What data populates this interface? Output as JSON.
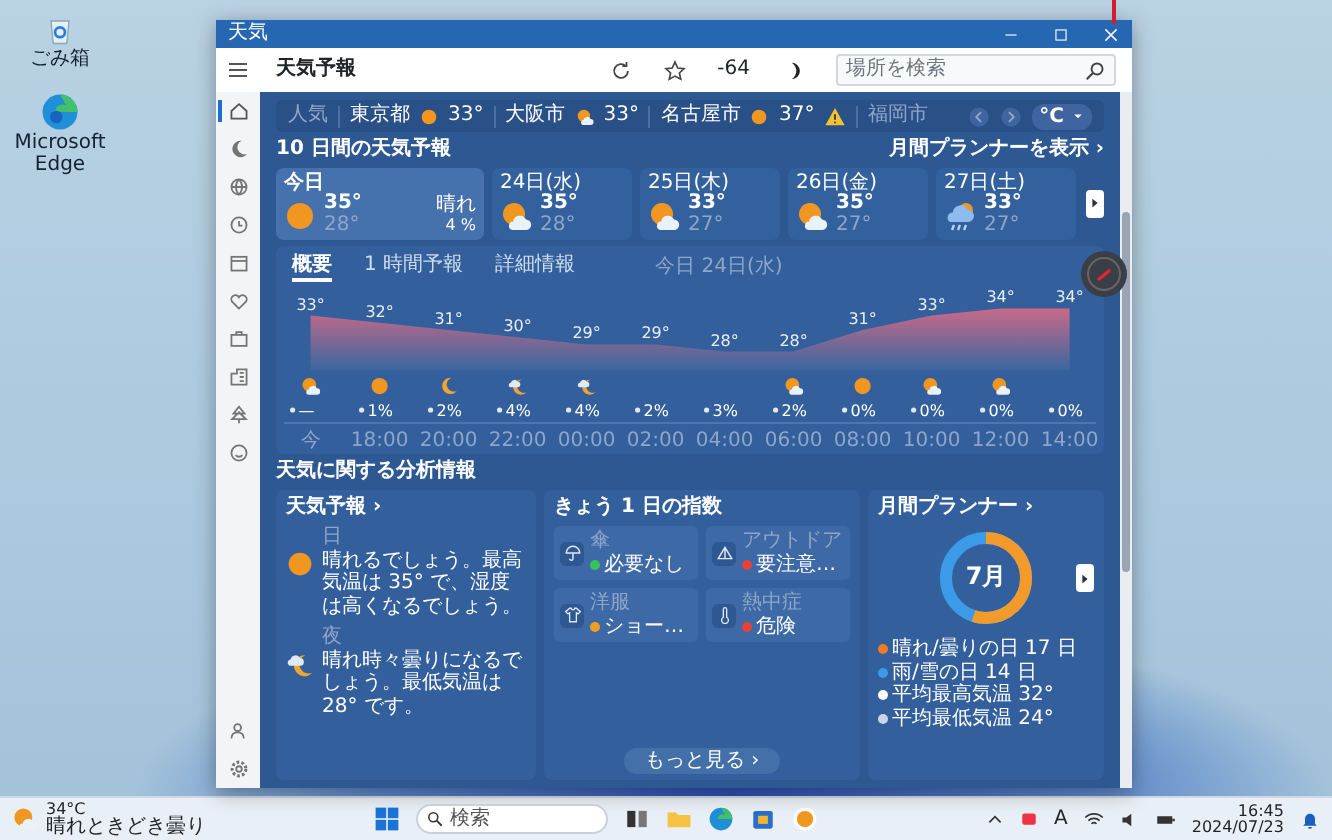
{
  "desktop_icons": [
    {
      "kind": "recycle-bin",
      "label": "ごみ箱"
    },
    {
      "kind": "browser",
      "label": "Microsoft Edge"
    }
  ],
  "window": {
    "title": "天気"
  },
  "header": {
    "title": "天気予報",
    "points": "-64",
    "search": {
      "placeholder": "場所を検索"
    }
  },
  "nav": [
    {
      "kind": "home",
      "selected": true
    },
    {
      "kind": "crescent",
      "selected": false
    },
    {
      "kind": "globe",
      "selected": false
    },
    {
      "kind": "clock",
      "selected": false
    },
    {
      "kind": "calendar",
      "selected": false
    },
    {
      "kind": "heart",
      "selected": false
    },
    {
      "kind": "briefcase",
      "selected": false
    },
    {
      "kind": "building",
      "selected": false
    },
    {
      "kind": "tree",
      "selected": false
    },
    {
      "kind": "smiley",
      "selected": false
    }
  ],
  "nav_bottom": [
    {
      "kind": "person",
      "selected": false
    },
    {
      "kind": "gear",
      "selected": false
    }
  ],
  "favorites": {
    "label": "人気",
    "unit": "°C",
    "cities": [
      {
        "name": "東京都",
        "kind": "sun",
        "temp": "33°",
        "alert": false,
        "disabled": false
      },
      {
        "name": "大阪市",
        "kind": "sun-cloud",
        "temp": "33°",
        "alert": false,
        "disabled": false
      },
      {
        "name": "名古屋市",
        "kind": "sun",
        "temp": "37°",
        "alert": true,
        "disabled": false
      },
      {
        "name": "福岡市",
        "alert": false,
        "disabled": true
      }
    ]
  },
  "forecast": {
    "title": "10 日間の天気予報",
    "link": "月間プランナーを表示 ›",
    "days": [
      {
        "label": "今日",
        "kind": "sun",
        "high": "35°",
        "low": "28°",
        "condition": "晴れ",
        "precip": "4 %",
        "selected": true
      },
      {
        "label": "24日(水)",
        "kind": "sun-cloud",
        "high": "35°",
        "low": "28°",
        "selected": false
      },
      {
        "label": "25日(木)",
        "kind": "sun-cloud",
        "high": "33°",
        "low": "27°",
        "selected": false
      },
      {
        "label": "26日(金)",
        "kind": "sun-cloud",
        "high": "35°",
        "low": "27°",
        "selected": false
      },
      {
        "label": "27日(土)",
        "kind": "cloud-rain",
        "high": "33°",
        "low": "27°",
        "selected": false
      }
    ]
  },
  "hourly": {
    "tabs": [
      {
        "label": "概要",
        "selected": true
      },
      {
        "label": "1 時間予報",
        "selected": false
      },
      {
        "label": "詳細情報",
        "selected": false
      }
    ],
    "day_label": "今日  24日(水)",
    "chart_data": {
      "type": "area",
      "categories": [
        "今",
        "18:00",
        "20:00",
        "22:00",
        "00:00",
        "02:00",
        "04:00",
        "06:00",
        "08:00",
        "10:00",
        "12:00",
        "14:00"
      ],
      "values": [
        33,
        32,
        31,
        30,
        29,
        29,
        28,
        28,
        31,
        33,
        34,
        34
      ],
      "value_labels": [
        "33°",
        "32°",
        "31°",
        "30°",
        "29°",
        "29°",
        "28°",
        "28°",
        "31°",
        "33°",
        "34°",
        "34°"
      ]
    },
    "slots": [
      {
        "kind": "sun-cloud",
        "precip": "—"
      },
      {
        "kind": "sun",
        "precip": "1%"
      },
      {
        "kind": "moon",
        "precip": "2%"
      },
      {
        "kind": "moon-cloud",
        "precip": "4%"
      },
      {
        "kind": "moon-cloud",
        "precip": "4%"
      },
      {
        "precip": "2%"
      },
      {
        "precip": "3%"
      },
      {
        "kind": "sun-cloud",
        "precip": "2%"
      },
      {
        "kind": "sun",
        "precip": "0%"
      },
      {
        "kind": "sun-cloud",
        "precip": "0%"
      },
      {
        "kind": "sun-cloud",
        "precip": "0%"
      },
      {
        "precip": "0%"
      }
    ]
  },
  "insights": {
    "title": "天気に関する分析情報",
    "summary": {
      "title": "天気予報 ›",
      "periods": [
        {
          "kind": "day",
          "label": "日",
          "text": "晴れるでしょう。最高気温は 35° で、湿度は高くなるでしょう。"
        },
        {
          "kind": "night",
          "label": "夜",
          "text": "晴れ時々曇りになるでしょう。最低気温は 28° です。"
        }
      ]
    },
    "indices": {
      "title": "きょう 1 日の指数",
      "more": "もっと見る ›",
      "items": [
        {
          "kind": "umbrella",
          "label": "傘",
          "status": "必要なし",
          "color": "#35c45a"
        },
        {
          "kind": "outdoor",
          "label": "アウトドア",
          "status": "要注意…",
          "color": "#e8403a"
        },
        {
          "kind": "laundry",
          "label": "洋服",
          "status": "ショー…",
          "color": "#f0a020"
        },
        {
          "kind": "thermometer",
          "label": "熱中症",
          "status": "危険",
          "color": "#e8403a"
        }
      ]
    },
    "planner": {
      "title": "月間プランナー ›",
      "month": "7月",
      "level": 0.55,
      "legend": [
        {
          "label": "晴れ/曇りの日 17 日",
          "color": "#f07a2a"
        },
        {
          "label": "雨/雪の日 14 日",
          "color": "#3b9be8"
        },
        {
          "label": "平均最高気温 32°",
          "color": "#ffffff"
        },
        {
          "label": "平均最低気温 24°",
          "color": "#c9d6ea"
        }
      ]
    }
  },
  "taskbar": {
    "weather": {
      "temp": "34°C",
      "condition": "晴れときどき曇り"
    },
    "search": {
      "placeholder": "検索"
    },
    "ime": "A",
    "time": "16:45",
    "date": "2024/07/23"
  }
}
